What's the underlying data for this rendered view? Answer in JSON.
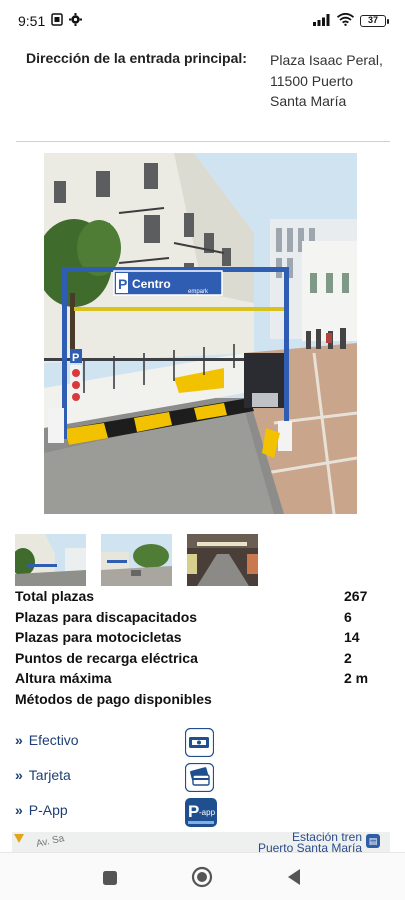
{
  "status_bar": {
    "time": "9:51",
    "battery": "37",
    "icons": [
      "sim-card-icon",
      "settings-gear-icon",
      "signal-bars-icon",
      "wifi-icon",
      "battery-icon"
    ]
  },
  "address": {
    "label": "Dirección de la entrada principal:",
    "value": "Plaza Isaac Peral, 11500 Puerto Santa María"
  },
  "photo": {
    "sign_text": "P  Centro",
    "sign_brand": "empark",
    "entrance_badge": "P",
    "colors": {
      "sky": "#cfe3f1",
      "frame": "#2f5db1",
      "curb_yellow": "#f2c200"
    }
  },
  "thumbnails": [
    "thumb-street-entrance",
    "thumb-plaza-view",
    "thumb-interior"
  ],
  "stats": [
    {
      "label": "Total plazas",
      "value": "267"
    },
    {
      "label": "Plazas para discapacitados",
      "value": "6"
    },
    {
      "label": "Plazas para motocicletas",
      "value": "14"
    },
    {
      "label": "Puntos de recarga eléctrica",
      "value": "2"
    },
    {
      "label": "Altura máxima",
      "value": "2 m"
    },
    {
      "label": "Métodos de pago disponibles",
      "value": ""
    }
  ],
  "payments": [
    {
      "label": "Efectivo",
      "icon": "cash-icon"
    },
    {
      "label": "Tarjeta",
      "icon": "card-icon"
    },
    {
      "label": "P-App",
      "icon": "p-app-icon"
    }
  ],
  "map": {
    "street": "Av. Sa",
    "station_line1": "Estación tren",
    "station_line2": "Puerto Santa María"
  },
  "nav": [
    "recents-button",
    "home-button",
    "back-button"
  ],
  "theme": {
    "accent": "#1f3f74",
    "divider": "#e8d77a",
    "icon_blue": "#1f4f8f"
  }
}
